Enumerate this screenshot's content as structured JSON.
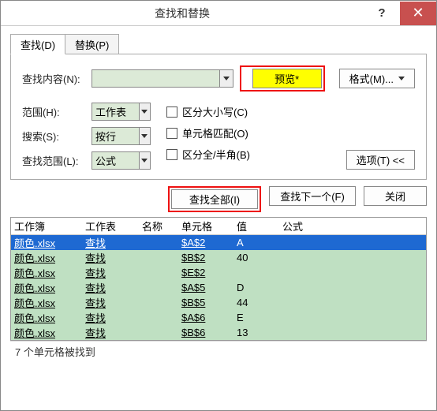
{
  "title": "查找和替换",
  "help": "?",
  "close": "✕",
  "tabs": {
    "find": "查找(D)",
    "replace": "替换(P)"
  },
  "labels": {
    "findwhat": "查找内容(N):",
    "within": "范围(H):",
    "search": "搜索(S):",
    "lookin": "查找范围(L):"
  },
  "combos": {
    "findwhat": "",
    "within": "工作表",
    "search": "按行",
    "lookin": "公式"
  },
  "preview": "预览*",
  "format_btn": "格式(M)...",
  "checks": {
    "case": "区分大小写(C)",
    "match": "单元格匹配(O)",
    "width": "区分全/半角(B)"
  },
  "options_btn": "选项(T) <<",
  "actions": {
    "findall": "查找全部(I)",
    "findnext": "查找下一个(F)",
    "close": "关闭"
  },
  "columns": {
    "book": "工作簿",
    "sheet": "工作表",
    "name": "名称",
    "cell": "单元格",
    "value": "值",
    "formula": "公式"
  },
  "rows": [
    {
      "book": "颜色.xlsx",
      "sheet": "查找",
      "name": "",
      "cell": "$A$2",
      "value": "A",
      "formula": "",
      "selected": true
    },
    {
      "book": "颜色.xlsx",
      "sheet": "查找",
      "name": "",
      "cell": "$B$2",
      "value": "40",
      "formula": "",
      "selected": false
    },
    {
      "book": "颜色.xlsx",
      "sheet": "查找",
      "name": "",
      "cell": "$E$2",
      "value": "",
      "formula": "",
      "selected": false
    },
    {
      "book": "颜色.xlsx",
      "sheet": "查找",
      "name": "",
      "cell": "$A$5",
      "value": "D",
      "formula": "",
      "selected": false
    },
    {
      "book": "颜色.xlsx",
      "sheet": "查找",
      "name": "",
      "cell": "$B$5",
      "value": "44",
      "formula": "",
      "selected": false
    },
    {
      "book": "颜色.xlsx",
      "sheet": "查找",
      "name": "",
      "cell": "$A$6",
      "value": "E",
      "formula": "",
      "selected": false
    },
    {
      "book": "颜色.xlsx",
      "sheet": "查找",
      "name": "",
      "cell": "$B$6",
      "value": "13",
      "formula": "",
      "selected": false
    }
  ],
  "status": "7 个单元格被找到"
}
